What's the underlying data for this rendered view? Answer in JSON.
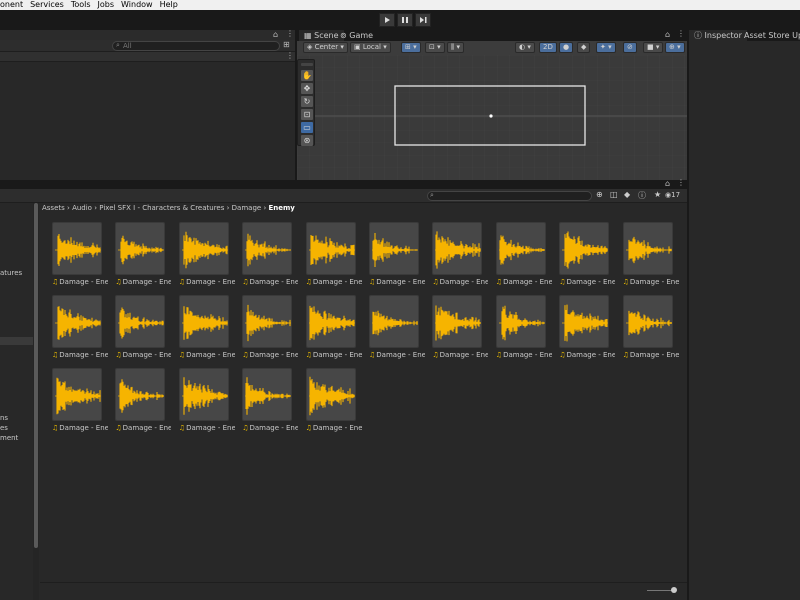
{
  "menu": [
    "onent",
    "Services",
    "Tools",
    "Jobs",
    "Window",
    "Help"
  ],
  "colors": {
    "waveform": "#f6b400",
    "selected_tool": "#3e6aa3"
  },
  "hierarchy": {
    "search_placeholder": "All"
  },
  "scene": {
    "tabs": [
      "Scene",
      "Game"
    ],
    "pivot_label": "Center",
    "space_label": "Local",
    "mode_2d": "2D"
  },
  "inspector": {
    "tabs": [
      "Inspector",
      "Asset Store Uploa"
    ]
  },
  "project": {
    "breadcrumb": [
      "Assets",
      "Audio",
      "Pixel SFX I - Characters & Creatures",
      "Damage",
      "Enemy"
    ],
    "hidden_count": "17",
    "sidebar_items": [
      "atures",
      "ns",
      "es",
      "ment"
    ],
    "assets": [
      {
        "label": "Damage - Enem"
      },
      {
        "label": "Damage - Enem"
      },
      {
        "label": "Damage - Enem"
      },
      {
        "label": "Damage - Enem"
      },
      {
        "label": "Damage - Enem"
      },
      {
        "label": "Damage - Enem"
      },
      {
        "label": "Damage - Enem"
      },
      {
        "label": "Damage - Enem"
      },
      {
        "label": "Damage - Enem"
      },
      {
        "label": "Damage - Enem"
      },
      {
        "label": "Damage - Enem"
      },
      {
        "label": "Damage - Enem"
      },
      {
        "label": "Damage - Enem"
      },
      {
        "label": "Damage - Enem"
      },
      {
        "label": "Damage - Enem"
      },
      {
        "label": "Damage - Enem"
      },
      {
        "label": "Damage - Enem"
      },
      {
        "label": "Damage - Enem"
      },
      {
        "label": "Damage - Enem"
      },
      {
        "label": "Damage - Enem"
      },
      {
        "label": "Damage - Enem"
      },
      {
        "label": "Damage - Enem"
      },
      {
        "label": "Damage - Enem"
      },
      {
        "label": "Damage - Enem"
      },
      {
        "label": "Damage - Enem"
      }
    ]
  }
}
